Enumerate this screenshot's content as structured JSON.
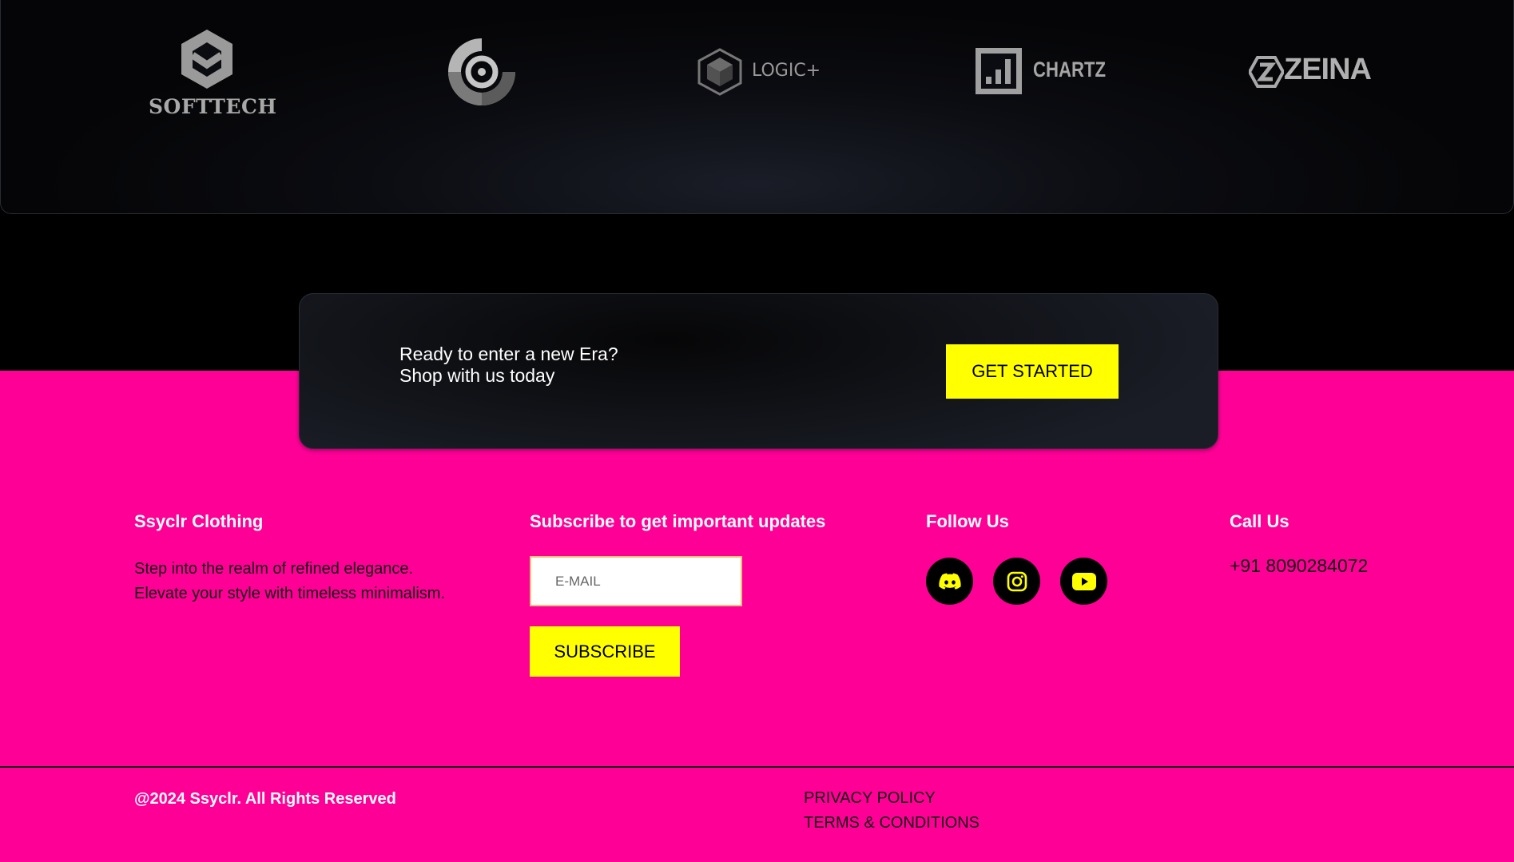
{
  "partners": [
    {
      "name": "SOFTTECH",
      "icon": "hexagon-m-icon"
    },
    {
      "name": "",
      "icon": "target-ring-icon"
    },
    {
      "name": "LOGIC+",
      "icon": "cube-hexagon-icon"
    },
    {
      "name": "CHARTZ",
      "icon": "bar-chart-square-icon"
    },
    {
      "name": "ZEINA",
      "icon": "z-hexagon-icon"
    }
  ],
  "cta": {
    "line1": "Ready to enter a new Era?",
    "line2": "Shop with us today",
    "button_label": "GET STARTED"
  },
  "footer": {
    "brand": {
      "title": "Ssyclr Clothing",
      "description": "Step into the realm of refined elegance. Elevate your style with timeless minimalism."
    },
    "subscribe": {
      "title": "Subscribe to get important updates",
      "email_placeholder": "E-MAIL",
      "button_label": "SUBSCRIBE"
    },
    "follow": {
      "title": "Follow Us",
      "icons": [
        "discord-icon",
        "instagram-icon",
        "youtube-icon"
      ]
    },
    "call": {
      "title": "Call Us",
      "phone": "+91 8090284072"
    },
    "copyright": "@2024 Ssyclr. All Rights Reserved",
    "links": {
      "privacy": "PRIVACY POLICY",
      "terms": "TERMS & CONDITIONS"
    }
  },
  "colors": {
    "pink": "#ff0097",
    "yellow": "#ffff00",
    "dark": "#000000",
    "logo_gray": "#9a9a9a"
  }
}
